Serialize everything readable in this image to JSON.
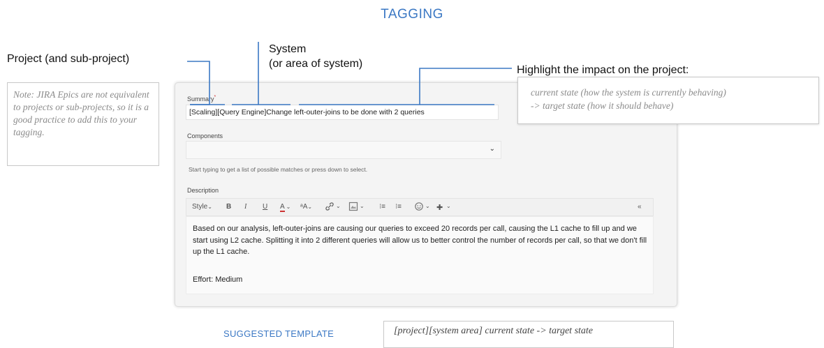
{
  "title": "TAGGING",
  "labels": {
    "project": "Project (and sub-project)",
    "system_line1": "System",
    "system_line2": "(or area of system)",
    "impact": "Highlight the impact on the project:"
  },
  "note": "Note: JIRA Epics are not equivalent to projects or sub-projects, so it is a good practice to add this to your tagging.",
  "impact_box": {
    "line1": "current state (how the system is currently behaving)",
    "line2": "-> target state (how it should behave)"
  },
  "form": {
    "summary_label": "Summary",
    "required_mark": "*",
    "summary_value": "[Scaling][Query Engine]Change left-outer-joins to be done with 2 queries",
    "components_label": "Components",
    "components_value": "",
    "components_hint": "Start typing to get a list of possible matches or press down to select.",
    "description_label": "Description",
    "toolbar": {
      "style": "Style",
      "bold": "B",
      "italic": "I",
      "underline": "U",
      "text_color": "A",
      "font_size": "ᵃA",
      "bullet_list": "⁝≡",
      "number_list": "⁝≡",
      "more": "✚",
      "collapse": "«"
    },
    "description_text": "Based on our analysis, left-outer-joins are causing our queries to exceed 20 records per call, causing the L1 cache to fill up and we start using L2 cache. Splitting it into 2 different queries will allow us to better control the number of records per call, so that we don't fill up the L1 cache.",
    "effort_text": "Effort: Medium"
  },
  "suggested_label": "SUGGESTED TEMPLATE",
  "suggested_template": "[project][system area] current state -> target state",
  "colors": {
    "accent": "#3b78c4",
    "connector": "#3b78c4"
  }
}
